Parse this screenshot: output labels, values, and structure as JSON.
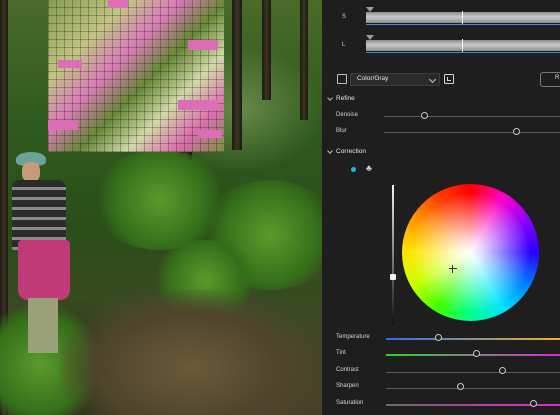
{
  "panel": {
    "top_sliders": [
      {
        "label": "S"
      },
      {
        "label": "L"
      }
    ],
    "mode": {
      "select_value": "Color/Gray",
      "right_button_label": "R"
    },
    "refine": {
      "title": "Refine",
      "rows": [
        {
          "label": "Denoise",
          "value": 0.23
        },
        {
          "label": "Blur",
          "value": 0.75
        }
      ]
    },
    "correction": {
      "title": "Correction",
      "rows": [
        {
          "label": "Temperature",
          "value": 0.3
        },
        {
          "label": "Tint",
          "value": 0.52
        },
        {
          "label": "Contrast",
          "value": 0.67
        },
        {
          "label": "Sharpen",
          "value": 0.43
        },
        {
          "label": "Saturation",
          "value": 0.85
        }
      ]
    }
  },
  "icons": {
    "mode_checkbox": "checkbox-icon",
    "snapshot": "camera-icon",
    "picker_dot": "color-dot-icon",
    "club": "club-icon",
    "section_arrow": "chevron-down-icon"
  },
  "colors": {
    "accent": "#1fb8e6",
    "panel_bg": "#1e1e1e"
  }
}
